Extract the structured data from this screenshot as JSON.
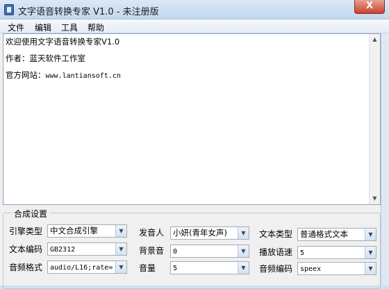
{
  "window": {
    "title": "文字语音转换专家 V1.0 - 未注册版",
    "close_glyph": "X"
  },
  "menu": [
    "文件",
    "编辑",
    "工具",
    "帮助"
  ],
  "editor": {
    "lines": [
      "欢迎使用文字语音转换专家V1.0",
      "作者：蓝天软件工作室",
      "官方网站："
    ],
    "url": "www.lantiansoft.cn"
  },
  "settings": {
    "title": "合成设置",
    "fields": [
      {
        "label": "引擎类型",
        "value": "中文合成引擎"
      },
      {
        "label": "发音人",
        "value": "小妍(青年女声)"
      },
      {
        "label": "文本类型",
        "value": "普通格式文本"
      },
      {
        "label": "文本编码",
        "value": "GB2312"
      },
      {
        "label": "背景音",
        "value": "0"
      },
      {
        "label": "播放语速",
        "value": "5"
      },
      {
        "label": "音频格式",
        "value": "audio/L16;rate="
      },
      {
        "label": "音量",
        "value": "5"
      },
      {
        "label": "音频编码",
        "value": "speex"
      }
    ]
  }
}
